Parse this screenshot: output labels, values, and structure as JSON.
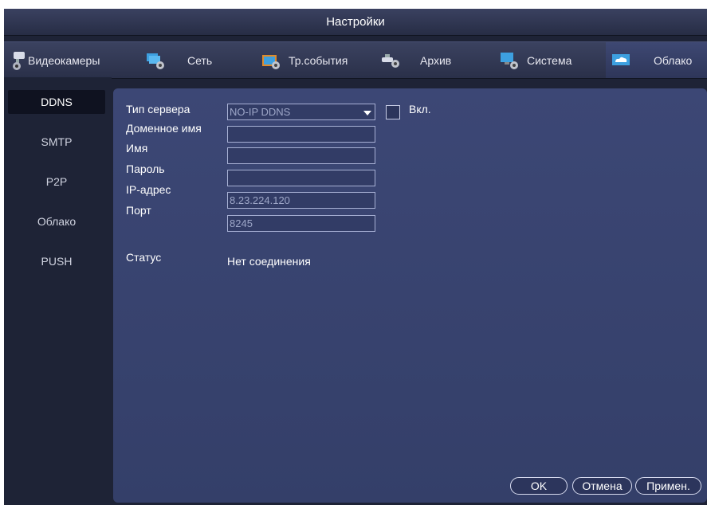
{
  "window": {
    "title": "Настройки"
  },
  "tabs": [
    {
      "label": "Видеокамеры",
      "icon": "camera-settings-icon"
    },
    {
      "label": "Сеть",
      "icon": "network-settings-icon"
    },
    {
      "label": "Тр.события",
      "icon": "events-settings-icon"
    },
    {
      "label": "Архив",
      "icon": "archive-settings-icon"
    },
    {
      "label": "Система",
      "icon": "system-settings-icon"
    },
    {
      "label": "Облако",
      "icon": "cloud-icon"
    }
  ],
  "sidebar": {
    "items": [
      "DDNS",
      "SMTP",
      "P2P",
      "Облако",
      "PUSH"
    ],
    "selected": "DDNS"
  },
  "form": {
    "server_type_label": "Тип сервера",
    "server_type_value": "NO-IP DDNS",
    "enable_label": "Вкл.",
    "enable_checked": false,
    "domain_label": "Доменное имя",
    "domain_value": "",
    "name_label": "Имя",
    "name_value": "",
    "password_label": "Пароль",
    "password_value": "",
    "ip_label": "IP-адрес",
    "ip_value": "8.23.224.120",
    "port_label": "Порт",
    "port_value": "8245",
    "status_label": "Статус",
    "status_value": "Нет соединения"
  },
  "buttons": {
    "ok": "OK",
    "cancel": "Отмена",
    "apply": "Примен."
  }
}
